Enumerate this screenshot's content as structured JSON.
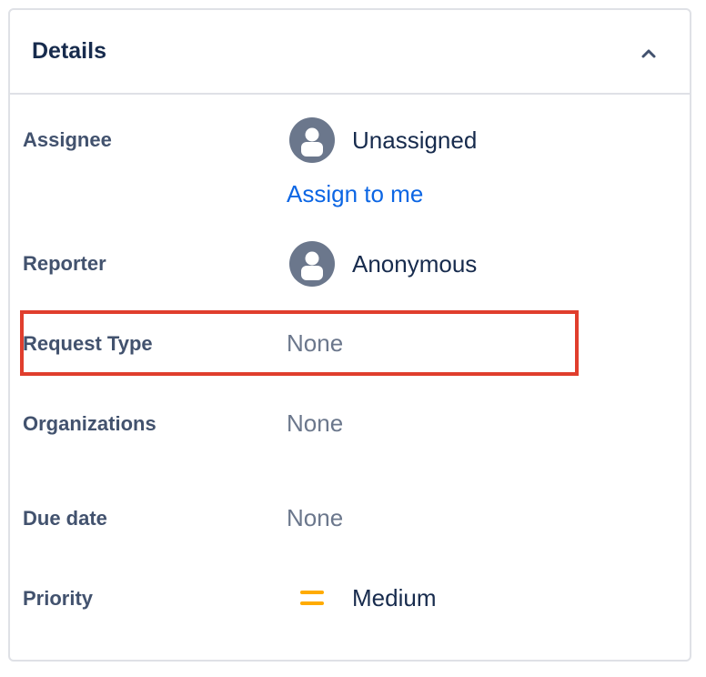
{
  "details": {
    "title": "Details",
    "collapse_icon": "chevron-up-icon",
    "fields": {
      "assignee": {
        "label": "Assignee",
        "value": "Unassigned",
        "action": "Assign to me",
        "icon": "user-avatar-icon"
      },
      "reporter": {
        "label": "Reporter",
        "value": "Anonymous",
        "icon": "user-avatar-icon"
      },
      "request_type": {
        "label": "Request Type",
        "value": "None"
      },
      "organizations": {
        "label": "Organizations",
        "value": "None"
      },
      "due_date": {
        "label": "Due date",
        "value": "None"
      },
      "priority": {
        "label": "Priority",
        "value": "Medium",
        "icon": "priority-medium-icon"
      }
    }
  },
  "colors": {
    "heading": "#172b4d",
    "label": "#42526e",
    "muted_value": "#6b778c",
    "link": "#0c66e4",
    "avatar": "#6b778c",
    "priority_medium": "#ffab00",
    "highlight": "#e03e2d",
    "border": "#dfe1e6"
  }
}
